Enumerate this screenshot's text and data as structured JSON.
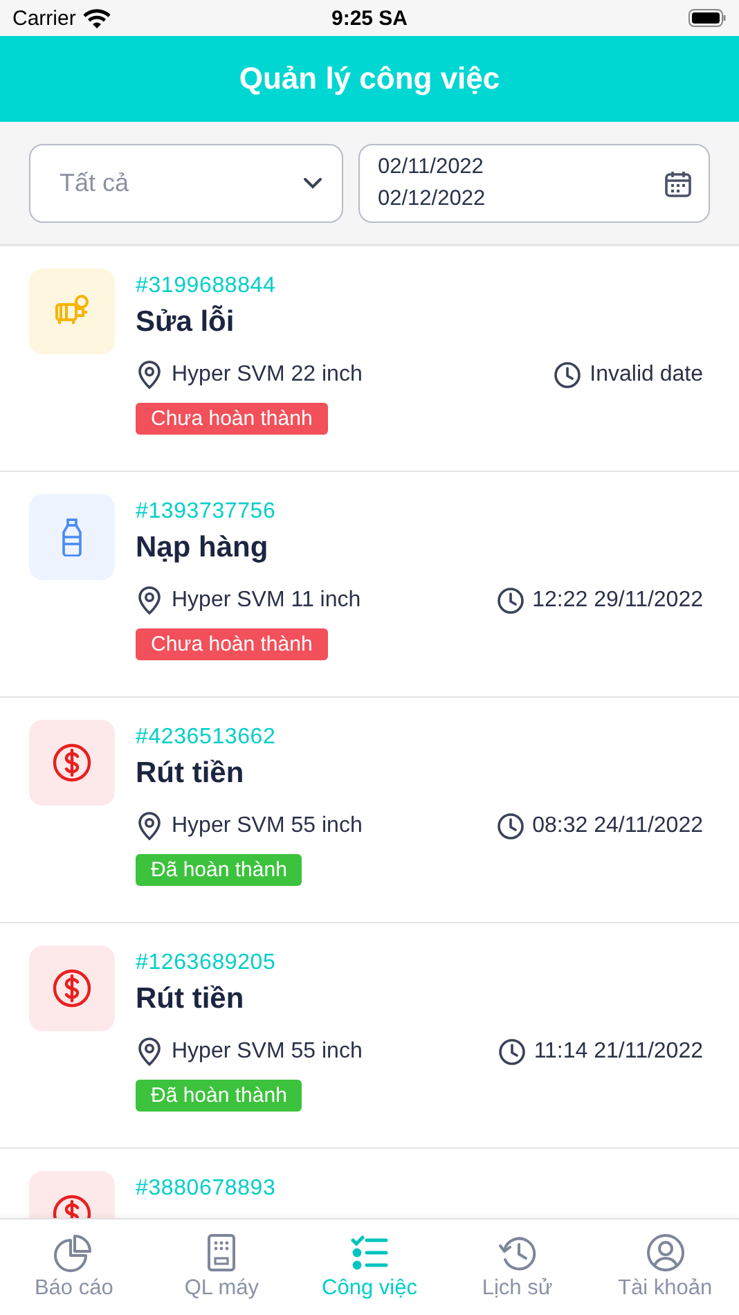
{
  "status_bar": {
    "carrier": "Carrier",
    "time": "9:25 SA"
  },
  "header": {
    "title": "Quản lý công việc"
  },
  "filters": {
    "type_select": {
      "placeholder": "Tất cả"
    },
    "date_range": {
      "from": "02/11/2022",
      "to": "02/12/2022"
    }
  },
  "tasks": [
    {
      "kind": "repair",
      "id": "#3199688844",
      "title": "Sửa lỗi",
      "machine": "Hyper SVM 22 inch",
      "time": "Invalid date",
      "status": "Chưa hoàn thành",
      "done": false
    },
    {
      "kind": "refill",
      "id": "#1393737756",
      "title": "Nạp hàng",
      "machine": "Hyper SVM 11 inch",
      "time": "12:22 29/11/2022",
      "status": "Chưa hoàn thành",
      "done": false
    },
    {
      "kind": "withdraw",
      "id": "#4236513662",
      "title": "Rút tiền",
      "machine": "Hyper SVM 55 inch",
      "time": "08:32 24/11/2022",
      "status": "Đã hoàn thành",
      "done": true
    },
    {
      "kind": "withdraw",
      "id": "#1263689205",
      "title": "Rút tiền",
      "machine": "Hyper SVM 55 inch",
      "time": "11:14 21/11/2022",
      "status": "Đã hoàn thành",
      "done": true
    },
    {
      "kind": "withdraw",
      "id": "#3880678893"
    }
  ],
  "tab_bar": [
    {
      "kind": "report",
      "label": "Báo cáo",
      "selected": false
    },
    {
      "kind": "machine",
      "label": "QL máy",
      "selected": false
    },
    {
      "kind": "tasks",
      "label": "Công việc",
      "selected": true
    },
    {
      "kind": "history",
      "label": "Lịch sử",
      "selected": false
    },
    {
      "kind": "account",
      "label": "Tài khoản",
      "selected": false
    }
  ]
}
